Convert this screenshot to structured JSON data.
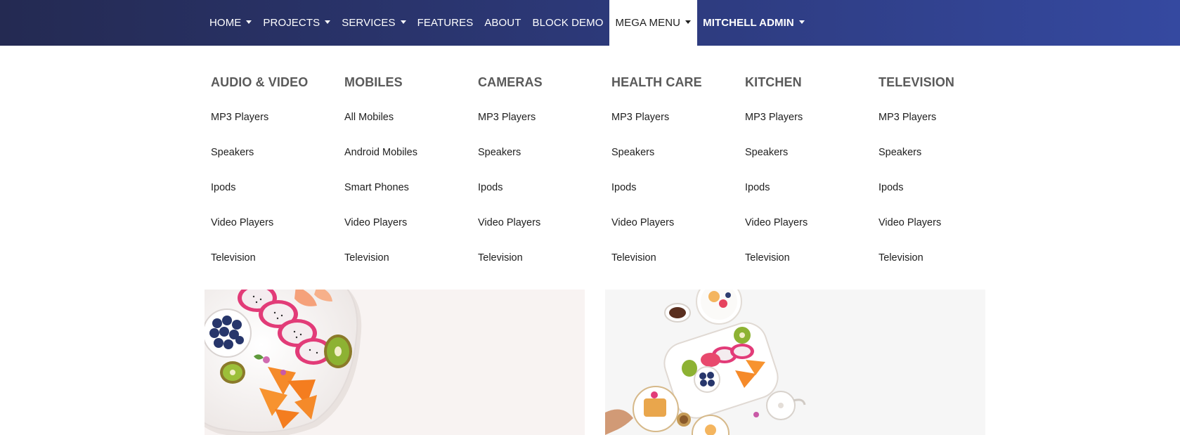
{
  "nav": {
    "items": [
      {
        "label": "HOME",
        "caret": true
      },
      {
        "label": "PROJECTS",
        "caret": true
      },
      {
        "label": "SERVICES",
        "caret": true
      },
      {
        "label": "FEATURES",
        "caret": false
      },
      {
        "label": "ABOUT",
        "caret": false
      },
      {
        "label": "BLOCK DEMO",
        "caret": false
      },
      {
        "label": "MEGA MENU",
        "caret": true,
        "active": true
      },
      {
        "label": "MITCHELL ADMIN",
        "caret": true,
        "bold": true
      }
    ]
  },
  "mega_menu": {
    "columns": [
      {
        "title": "AUDIO & VIDEO",
        "links": [
          "MP3 Players",
          "Speakers",
          "Ipods",
          "Video Players",
          "Television"
        ]
      },
      {
        "title": "MOBILES",
        "links": [
          "All Mobiles",
          "Android Mobiles",
          "Smart Phones",
          "Video Players",
          "Television"
        ]
      },
      {
        "title": "CAMERAS",
        "links": [
          "MP3 Players",
          "Speakers",
          "Ipods",
          "Video Players",
          "Television"
        ]
      },
      {
        "title": "HEALTH CARE",
        "links": [
          "MP3 Players",
          "Speakers",
          "Ipods",
          "Video Players",
          "Television"
        ]
      },
      {
        "title": "KITCHEN",
        "links": [
          "MP3 Players",
          "Speakers",
          "Ipods",
          "Video Players",
          "Television"
        ]
      },
      {
        "title": "TELEVISION",
        "links": [
          "MP3 Players",
          "Speakers",
          "Ipods",
          "Video Players",
          "Television"
        ]
      }
    ]
  },
  "banners": [
    {
      "image": "fruit-platter-image"
    },
    {
      "image": "breakfast-table-image"
    }
  ],
  "colors": {
    "navbar_start": "#242a52",
    "navbar_end": "#3549a0",
    "heading": "#5a5a5a"
  }
}
